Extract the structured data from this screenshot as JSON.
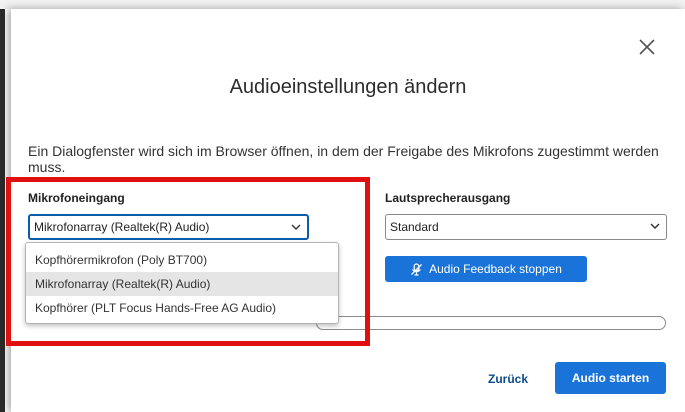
{
  "dialog": {
    "title": "Audioeinstellungen ändern",
    "hint": "Ein Dialogfenster wird sich im Browser öffnen, in dem der Freigabe des Mikrofons zugestimmt werden muss.",
    "close_icon": "close-icon"
  },
  "microphone": {
    "label": "Mikrofoneingang",
    "selected": "Mikrofonarray (Realtek(R) Audio)",
    "options": [
      "Kopfhörermikrofon (Poly BT700)",
      "Mikrofonarray (Realtek(R) Audio)",
      "Kopfhörer (PLT Focus Hands-Free AG Audio)"
    ],
    "highlighted_option_index": 1
  },
  "speaker": {
    "label": "Lautsprecherausgang",
    "selected": "Standard",
    "feedback_button": "Audio Feedback stoppen",
    "feedback_icon": "microphone-off-icon"
  },
  "audio_level": 0.0,
  "footer": {
    "back_label": "Zurück",
    "start_label": "Audio starten"
  },
  "colors": {
    "accent": "#1a73d9",
    "focus": "#0b5cab",
    "annotation": "#e01010"
  }
}
